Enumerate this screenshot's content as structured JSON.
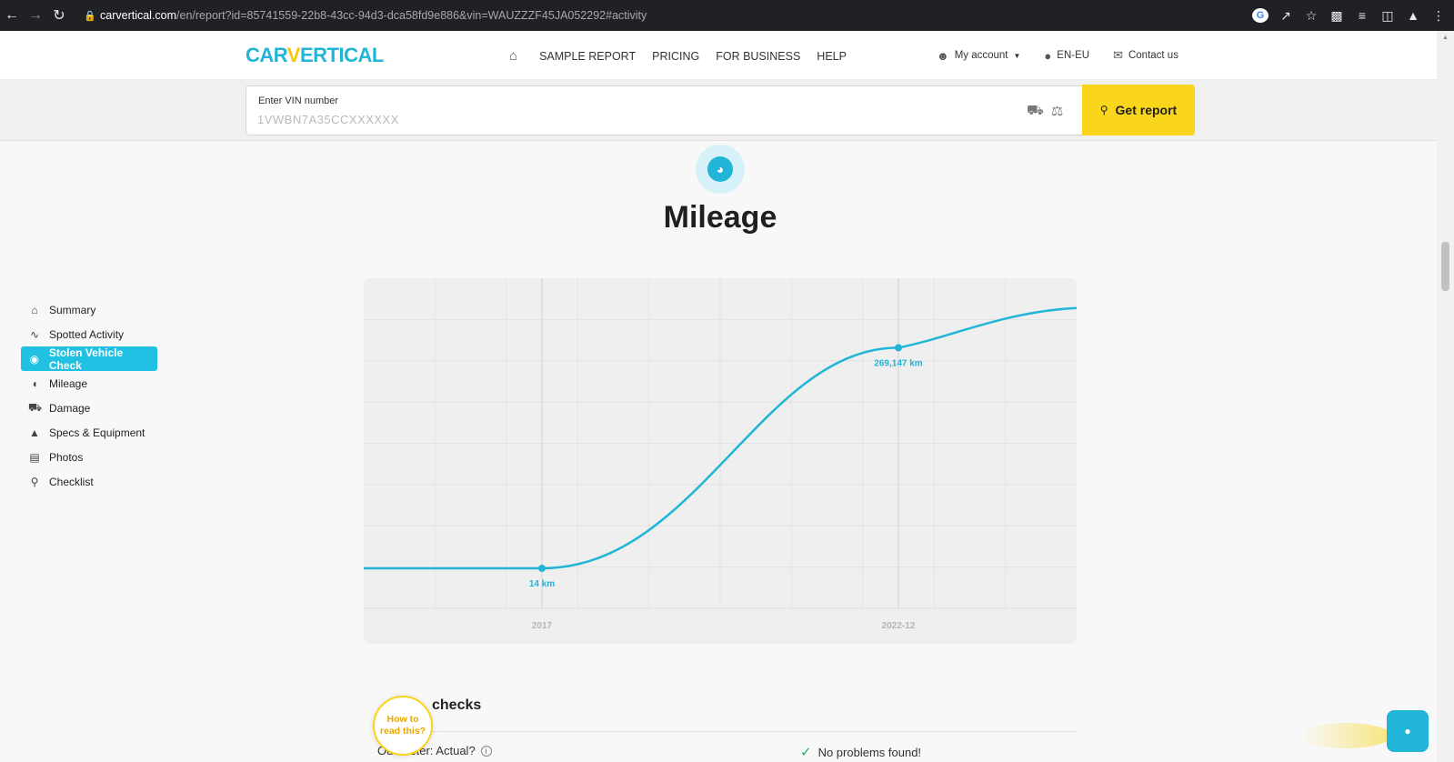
{
  "browser": {
    "url_host": "carvertical.com",
    "url_path": "/en/report?id=85741559-22b8-43cc-94d3-dca58fd9e886&vin=WAUZZZF45JA052292#activity"
  },
  "header": {
    "logo_left": "CAR",
    "logo_v": "V",
    "logo_right": "ERTICAL",
    "nav": [
      "SAMPLE REPORT",
      "PRICING",
      "FOR BUSINESS",
      "HELP"
    ],
    "account": "My account",
    "locale": "EN-EU",
    "contact": "Contact us"
  },
  "vin_search": {
    "label": "Enter VIN number",
    "placeholder": "1VWBN7A35CCXXXXXX",
    "button": "Get report"
  },
  "sidebar": {
    "items": [
      {
        "label": "Summary",
        "icon": "home-icon",
        "active": false
      },
      {
        "label": "Spotted Activity",
        "icon": "activity-icon",
        "active": false
      },
      {
        "label": "Stolen Vehicle Check",
        "icon": "shield-icon",
        "active": true
      },
      {
        "label": "Mileage",
        "icon": "gauge-icon",
        "active": false
      },
      {
        "label": "Damage",
        "icon": "car-damage-icon",
        "active": false
      },
      {
        "label": "Specs & Equipment",
        "icon": "equipment-icon",
        "active": false
      },
      {
        "label": "Photos",
        "icon": "photo-icon",
        "active": false
      },
      {
        "label": "Checklist",
        "icon": "magnifier-icon",
        "active": false
      }
    ]
  },
  "section": {
    "title": "Mileage"
  },
  "chart_data": {
    "type": "line",
    "x": [
      "2017",
      "2022-12"
    ],
    "series": [
      {
        "values": [
          14,
          269147
        ]
      }
    ],
    "point_labels": [
      "14 km",
      "269,147 km"
    ],
    "xlabel": "",
    "ylabel": "",
    "grid": true,
    "legend": "none"
  },
  "checks": {
    "title_visible": "checks",
    "row_label": "Odometer: Actual?",
    "row_status": "No problems found!",
    "how_to": "How to read this?"
  },
  "colors": {
    "brand_blue": "#21b5d7",
    "brand_yellow": "#f9d51b",
    "active_sidebar": "#20c1e3"
  }
}
